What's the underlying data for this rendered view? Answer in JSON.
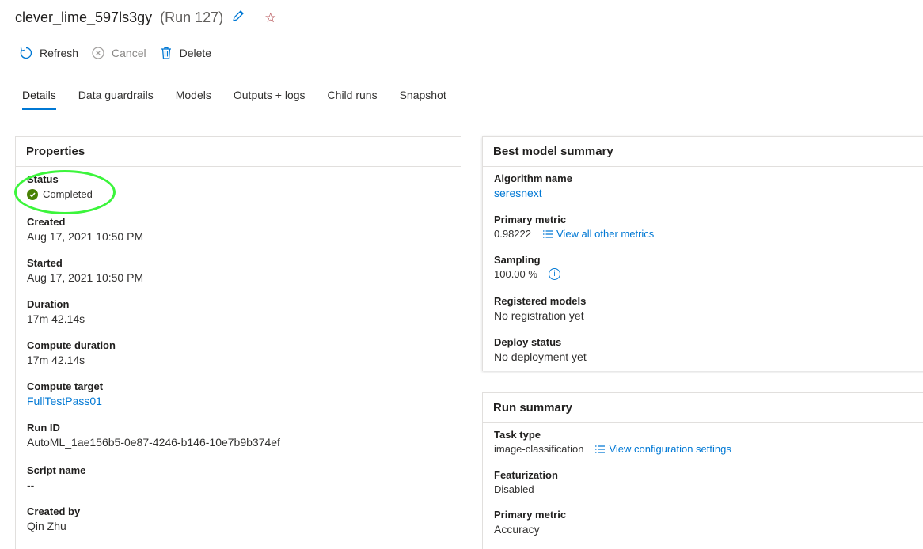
{
  "header": {
    "run_name": "clever_lime_597ls3gy",
    "run_number": "(Run 127)"
  },
  "toolbar": {
    "refresh_label": "Refresh",
    "cancel_label": "Cancel",
    "delete_label": "Delete"
  },
  "tabs": [
    {
      "label": "Details",
      "active": true
    },
    {
      "label": "Data guardrails"
    },
    {
      "label": "Models"
    },
    {
      "label": "Outputs + logs"
    },
    {
      "label": "Child runs"
    },
    {
      "label": "Snapshot"
    }
  ],
  "properties": {
    "title": "Properties",
    "status_label": "Status",
    "status_value": "Completed",
    "created_label": "Created",
    "created_value": "Aug 17, 2021 10:50 PM",
    "started_label": "Started",
    "started_value": "Aug 17, 2021 10:50 PM",
    "duration_label": "Duration",
    "duration_value": "17m 42.14s",
    "compute_duration_label": "Compute duration",
    "compute_duration_value": "17m 42.14s",
    "compute_target_label": "Compute target",
    "compute_target_value": "FullTestPass01",
    "run_id_label": "Run ID",
    "run_id_value": "AutoML_1ae156b5-0e87-4246-b146-10e7b9b374ef",
    "script_name_label": "Script name",
    "script_name_value": "--",
    "created_by_label": "Created by",
    "created_by_value": "Qin Zhu"
  },
  "best_model": {
    "title": "Best model summary",
    "algorithm_label": "Algorithm name",
    "algorithm_value": "seresnext",
    "primary_metric_label": "Primary metric",
    "primary_metric_value": "0.98222",
    "view_metrics_link": "View all other metrics",
    "sampling_label": "Sampling",
    "sampling_value": "100.00 %",
    "registered_label": "Registered models",
    "registered_value": "No registration yet",
    "deploy_label": "Deploy status",
    "deploy_value": "No deployment yet"
  },
  "run_summary": {
    "title": "Run summary",
    "task_type_label": "Task type",
    "task_type_value": "image-classification",
    "view_config_link": "View configuration settings",
    "featurization_label": "Featurization",
    "featurization_value": "Disabled",
    "primary_metric_label": "Primary metric",
    "primary_metric_value": "Accuracy"
  },
  "colors": {
    "accent": "#0078d4",
    "status_success": "#498205",
    "annotation": "#3cf53c",
    "star": "#a4262c"
  }
}
